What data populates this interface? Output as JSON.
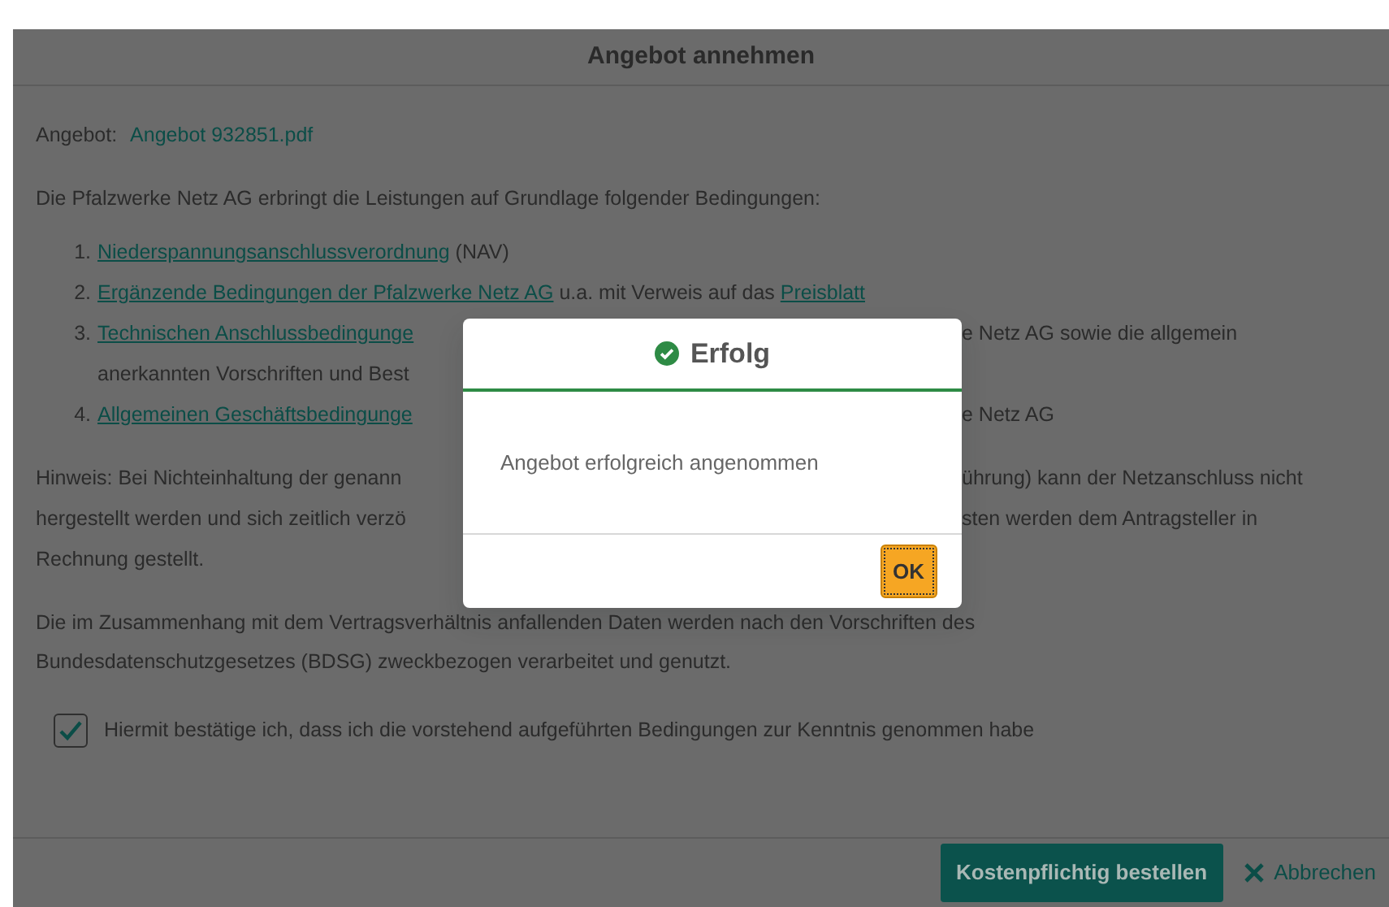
{
  "dialog": {
    "title": "Angebot annehmen",
    "offer_label": "Angebot:",
    "offer_file": "Angebot 932851.pdf",
    "intro": "Die Pfalzwerke Netz AG erbringt die Leistungen auf Grundlage folgender Bedingungen:",
    "conditions": [
      {
        "marker": "1.",
        "left": [
          {
            "text": "Niederspannungsanschlussverordnung",
            "link": true
          },
          {
            "text": " (NAV)",
            "link": false
          }
        ]
      },
      {
        "marker": "2.",
        "left": [
          {
            "text": "Ergänzende Bedingungen der Pfalzwerke Netz AG",
            "link": true
          },
          {
            "text": " u.a. mit Verweis auf das ",
            "link": false
          },
          {
            "text": "Preisblatt",
            "link": true
          }
        ]
      },
      {
        "marker": "3.",
        "left": [
          {
            "text": "Technischen Anschlussbedingunge",
            "link": true
          }
        ],
        "right": [
          {
            "text": "e Netz AG sowie die allgemein",
            "link": false
          }
        ]
      },
      {
        "left": [
          {
            "text": "anerkannten Vorschriften und Best",
            "link": false
          }
        ]
      },
      {
        "marker": "4.",
        "left": [
          {
            "text": "Allgemeinen Geschäftsbedingunge",
            "link": true
          }
        ],
        "right": [
          {
            "text": "e Netz AG",
            "link": false
          }
        ]
      }
    ],
    "note": [
      {
        "left": [
          {
            "text": "Hinweis: Bei Nichteinhaltung der genann",
            "link": false
          }
        ],
        "right": [
          {
            "text": "ührung) kann der Netzanschluss nicht",
            "link": false
          }
        ]
      },
      {
        "left": [
          {
            "text": "hergestellt werden und sich zeitlich verzö",
            "link": false
          }
        ],
        "right": [
          {
            "text": "sten werden dem Antragsteller in",
            "link": false
          }
        ]
      },
      {
        "left": [
          {
            "text": "Rechnung gestellt.",
            "link": false
          }
        ]
      }
    ],
    "privacy": "Die im Zusammenhang mit dem Vertragsverhältnis anfallenden Daten werden nach den Vorschriften des Bundesdatenschutzgesetzes (BDSG) zweckbezogen verarbeitet und genutzt.",
    "confirm": {
      "label": "Hiermit bestätige ich, dass ich die vorstehend aufgeführten Bedingungen zur Kenntnis genommen habe",
      "checked": true
    },
    "buttons": [
      {
        "label": "Kostenpflichtig bestellen",
        "kind": "primary"
      },
      {
        "label": "Abbrechen",
        "kind": "cancel"
      }
    ]
  },
  "alert": {
    "title": "Erfolg",
    "message": "Angebot erfolgreich angenommen",
    "button": "OK"
  }
}
